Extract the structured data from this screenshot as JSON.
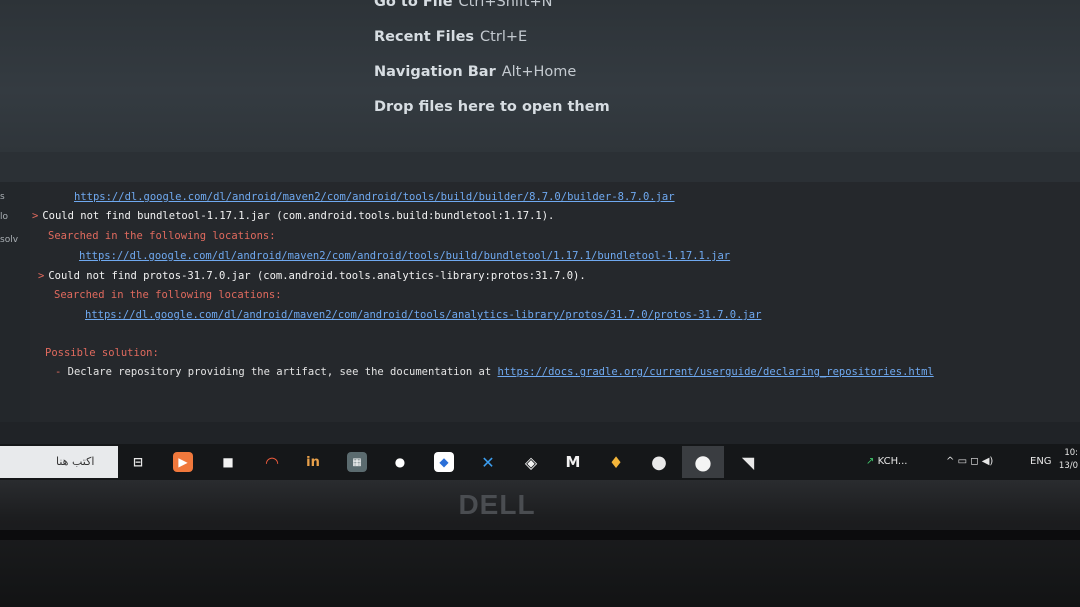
{
  "editor_hints": [
    {
      "label": "Go to File",
      "shortcut": "Ctrl+Shift+N"
    },
    {
      "label": "Recent Files",
      "shortcut": "Ctrl+E"
    },
    {
      "label": "Navigation Bar",
      "shortcut": "Alt+Home"
    },
    {
      "label": "Drop files here to open them",
      "shortcut": ""
    }
  ],
  "left_panel": {
    "fragments": [
      "s",
      "lo",
      "solv"
    ]
  },
  "build_output": {
    "link_builder": "https://dl.google.com/dl/android/maven2/com/android/tools/build/builder/8.7.0/builder-8.7.0.jar",
    "error1": "Could not find bundletool-1.17.1.jar (com.android.tools.build:bundletool:1.17.1).",
    "searched1": "Searched in the following locations:",
    "link_bundletool": "https://dl.google.com/dl/android/maven2/com/android/tools/build/bundletool/1.17.1/bundletool-1.17.1.jar",
    "error2": "Could not find protos-31.7.0.jar (com.android.tools.analytics-library:protos:31.7.0).",
    "searched2": "Searched in the following locations:",
    "link_protos": "https://dl.google.com/dl/android/maven2/com/android/tools/analytics-library/protos/31.7.0/protos-31.7.0.jar",
    "solution_heading": "Possible solution:",
    "solution_text": "Declare repository providing the artifact, see the documentation at",
    "solution_link": "https://docs.gradle.org/current/userguide/declaring_repositories.html",
    "error_marker": ">",
    "dash": "-"
  },
  "taskbar": {
    "search_text": "ﺍﻛﺘﺐ ﻫﻨﺎ",
    "apps": [
      {
        "name": "task-view-icon",
        "glyph": "⊟"
      },
      {
        "name": "media-app-icon",
        "glyph": "▶"
      },
      {
        "name": "files-app-icon",
        "glyph": "■"
      },
      {
        "name": "android-studio-icon",
        "glyph": "◠"
      },
      {
        "name": "linkedin-icon",
        "glyph": "in"
      },
      {
        "name": "minecraft-icon",
        "glyph": "▦"
      },
      {
        "name": "chat-app-icon",
        "glyph": "●"
      },
      {
        "name": "app-icon",
        "glyph": "◆"
      },
      {
        "name": "vscode-icon",
        "glyph": "✕"
      },
      {
        "name": "unity-icon",
        "glyph": "◈"
      },
      {
        "name": "gmail-icon",
        "glyph": "M"
      },
      {
        "name": "flame-app-icon",
        "glyph": "♦"
      },
      {
        "name": "chrome-icon",
        "glyph": "●"
      },
      {
        "name": "chrome-profile-icon",
        "glyph": "●"
      },
      {
        "name": "notes-app-icon",
        "glyph": "◥"
      }
    ],
    "tray_stock": "KCH...",
    "tray_lang": "ENG",
    "clock_time": "10:",
    "clock_date": "13/0"
  },
  "bezel": {
    "brand": "DELL"
  },
  "colors": {
    "link": "#6fa9f0",
    "error_red": "#e06a5e",
    "console_bg": "#25282c"
  }
}
